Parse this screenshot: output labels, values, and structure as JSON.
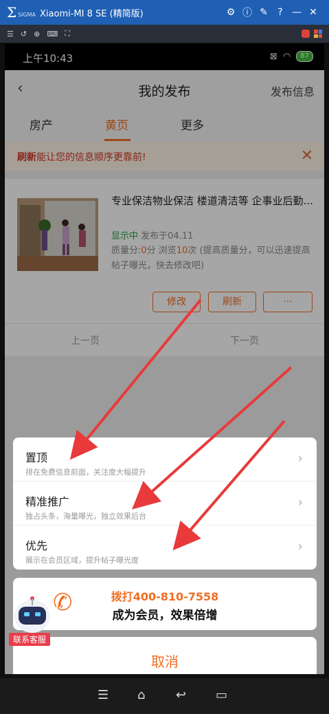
{
  "window": {
    "title": "Xiaomi-MI 8 SE (精简版)",
    "brand": "SIGMA"
  },
  "status_bar": {
    "time": "上午10:43",
    "battery": "87"
  },
  "header": {
    "title": "我的发布",
    "right_action": "发布信息"
  },
  "tabs": [
    {
      "label": "房产",
      "active": false
    },
    {
      "label": "黄页",
      "active": true
    },
    {
      "label": "更多",
      "active": false
    }
  ],
  "notice": {
    "highlight": "刷新",
    "text": "能让您的信息顺序更靠前!"
  },
  "post": {
    "title": "专业保洁物业保洁 楼道清洁等 企事业后勤...",
    "status": "显示中",
    "published": "发布于04.11",
    "quality_prefix": "质量分:",
    "quality_score": "0",
    "quality_unit": "分 浏览",
    "views": "10",
    "quality_suffix": "次 (提高质量分，可以迅速提高帖子曝光，快去修改吧)",
    "buttons": {
      "edit": "修改",
      "refresh": "刷新",
      "more": "···"
    }
  },
  "pager": {
    "prev": "上一页",
    "next": "下一页"
  },
  "sheet": {
    "options": [
      {
        "title": "置顶",
        "subtitle": "排在免费信息前面，关注度大幅提升"
      },
      {
        "title": "精准推广",
        "subtitle": "独占头条，海量曝光，独立效果后台"
      },
      {
        "title": "优先",
        "subtitle": "展示在会员区域，提升帖子曝光度"
      }
    ],
    "call_number": "拨打400-810-7558",
    "call_text": "成为会员，效果倍增",
    "cancel": "取消",
    "service_badge": "联系客服"
  },
  "colors": {
    "accent": "#f26d22",
    "green": "#2b9a3c",
    "red": "#e83d4a",
    "emulator": "#1f5fb4"
  }
}
